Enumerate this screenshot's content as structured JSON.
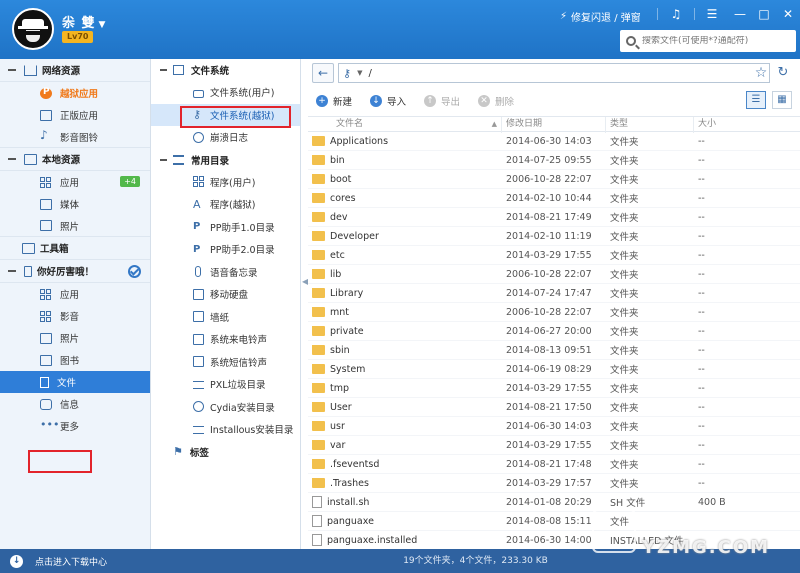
{
  "header": {
    "username": "尜 雙",
    "level": "Lv70",
    "repair_label": "修复闪退 / 弹窗",
    "search_placeholder": "搜索文件(可使用*?通配符)"
  },
  "left_nav": {
    "net_group": "网络资源",
    "net_items": [
      "越狱应用",
      "正版应用",
      "影音图铃"
    ],
    "local_group": "本地资源",
    "local_items": [
      "应用",
      "媒体",
      "照片"
    ],
    "local_app_badge": "+4",
    "toolbox": "工具箱",
    "device_group": "你好厉害哦！",
    "device_items": [
      "应用",
      "影音",
      "照片",
      "图书",
      "文件",
      "信息",
      "更多"
    ]
  },
  "tree": {
    "fs_group": "文件系统",
    "fs_items": [
      "文件系统(用户)",
      "文件系统(越狱)",
      "崩溃日志"
    ],
    "common_group": "常用目录",
    "common_items": [
      "程序(用户)",
      "程序(越狱)",
      "PP助手1.0目录",
      "PP助手2.0目录",
      "语音备忘录",
      "移动硬盘",
      "墙纸",
      "系统来电铃声",
      "系统短信铃声",
      "PXL垃圾目录",
      "Cydia安装目录",
      "Installous安装目录"
    ],
    "tags_group": "标签"
  },
  "browser": {
    "path": "/",
    "toolbar": {
      "new": "新建",
      "import": "导入",
      "export": "导出",
      "delete": "删除"
    },
    "columns": {
      "name": "文件名",
      "date": "修改日期",
      "type": "类型",
      "size": "大小"
    },
    "rows": [
      {
        "name": "Applications",
        "date": "2014-06-30 14:03",
        "type": "文件夹",
        "size": "--",
        "kind": "folder"
      },
      {
        "name": "bin",
        "date": "2014-07-25 09:55",
        "type": "文件夹",
        "size": "--",
        "kind": "folder"
      },
      {
        "name": "boot",
        "date": "2006-10-28 22:07",
        "type": "文件夹",
        "size": "--",
        "kind": "folder"
      },
      {
        "name": "cores",
        "date": "2014-02-10 10:44",
        "type": "文件夹",
        "size": "--",
        "kind": "folder"
      },
      {
        "name": "dev",
        "date": "2014-08-21 17:49",
        "type": "文件夹",
        "size": "--",
        "kind": "folder"
      },
      {
        "name": "Developer",
        "date": "2014-02-10 11:19",
        "type": "文件夹",
        "size": "--",
        "kind": "folder"
      },
      {
        "name": "etc",
        "date": "2014-03-29 17:55",
        "type": "文件夹",
        "size": "--",
        "kind": "folder"
      },
      {
        "name": "lib",
        "date": "2006-10-28 22:07",
        "type": "文件夹",
        "size": "--",
        "kind": "folder"
      },
      {
        "name": "Library",
        "date": "2014-07-24 17:47",
        "type": "文件夹",
        "size": "--",
        "kind": "folder"
      },
      {
        "name": "mnt",
        "date": "2006-10-28 22:07",
        "type": "文件夹",
        "size": "--",
        "kind": "folder"
      },
      {
        "name": "private",
        "date": "2014-06-27 20:00",
        "type": "文件夹",
        "size": "--",
        "kind": "folder"
      },
      {
        "name": "sbin",
        "date": "2014-08-13 09:51",
        "type": "文件夹",
        "size": "--",
        "kind": "folder"
      },
      {
        "name": "System",
        "date": "2014-06-19 08:29",
        "type": "文件夹",
        "size": "--",
        "kind": "folder"
      },
      {
        "name": "tmp",
        "date": "2014-03-29 17:55",
        "type": "文件夹",
        "size": "--",
        "kind": "folder"
      },
      {
        "name": "User",
        "date": "2014-08-21 17:50",
        "type": "文件夹",
        "size": "--",
        "kind": "folder"
      },
      {
        "name": "usr",
        "date": "2014-06-30 14:03",
        "type": "文件夹",
        "size": "--",
        "kind": "folder"
      },
      {
        "name": "var",
        "date": "2014-03-29 17:55",
        "type": "文件夹",
        "size": "--",
        "kind": "folder"
      },
      {
        "name": ".fseventsd",
        "date": "2014-08-21 17:48",
        "type": "文件夹",
        "size": "--",
        "kind": "folder"
      },
      {
        "name": ".Trashes",
        "date": "2014-03-29 17:57",
        "type": "文件夹",
        "size": "--",
        "kind": "folder"
      },
      {
        "name": "install.sh",
        "date": "2014-01-08 20:29",
        "type": "SH 文件",
        "size": "400 B",
        "kind": "file"
      },
      {
        "name": "panguaxe",
        "date": "2014-08-08 15:11",
        "type": "文件",
        "size": "",
        "kind": "file"
      },
      {
        "name": "panguaxe.installed",
        "date": "2014-06-30 14:00",
        "type": "INSTALLED 文件",
        "size": "",
        "kind": "file"
      }
    ]
  },
  "bottom": {
    "download_label": "点击进入下载中心",
    "status": "19个文件夹，4个文件，233.30 KB"
  },
  "watermark": "YZMG.COM",
  "colors": {
    "header": "#1f73c6",
    "accent": "#2f7ed8",
    "highlight": "#e2232b",
    "folder": "#f2c04c"
  }
}
